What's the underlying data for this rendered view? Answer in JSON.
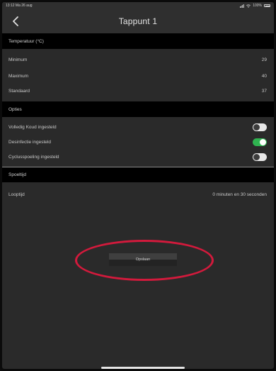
{
  "status_bar": {
    "time_date": "13:12  Ma 26 aug",
    "battery": "100%"
  },
  "nav": {
    "title": "Tappunt 1",
    "back_icon": "chevron-left-icon"
  },
  "temperature": {
    "header": "Temperatuur (°C)",
    "rows": [
      {
        "label": "Minimum",
        "value": "29"
      },
      {
        "label": "Maximum",
        "value": "40"
      },
      {
        "label": "Standaard",
        "value": "37"
      }
    ]
  },
  "options": {
    "header": "Opties",
    "rows": [
      {
        "label": "Volledig Koud ingesteld",
        "on": false
      },
      {
        "label": "Desinfectie ingesteld",
        "on": true
      },
      {
        "label": "Cyclusspoeling ingesteld",
        "on": false
      }
    ]
  },
  "flush_time": {
    "header": "Spoeltijd",
    "label": "Looptijd",
    "value": "0 minuten en 30 seconden"
  },
  "actions": {
    "save_label": "Opslaan"
  },
  "colors": {
    "background": "#2a2a2a",
    "section_header": "#000000",
    "toggle_on": "#2fb350",
    "toggle_off": "#e8e8e8",
    "highlight": "#d21a3c"
  }
}
